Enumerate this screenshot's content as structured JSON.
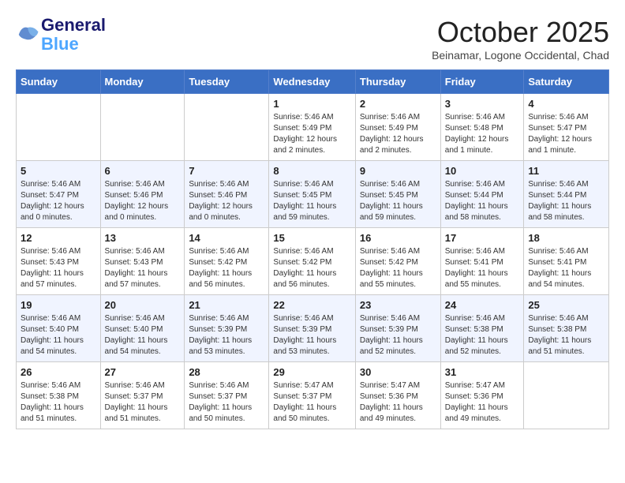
{
  "header": {
    "logo_line1": "General",
    "logo_line2": "Blue",
    "month": "October 2025",
    "location": "Beinamar, Logone Occidental, Chad"
  },
  "days_of_week": [
    "Sunday",
    "Monday",
    "Tuesday",
    "Wednesday",
    "Thursday",
    "Friday",
    "Saturday"
  ],
  "weeks": [
    [
      {
        "day": "",
        "info": ""
      },
      {
        "day": "",
        "info": ""
      },
      {
        "day": "",
        "info": ""
      },
      {
        "day": "1",
        "info": "Sunrise: 5:46 AM\nSunset: 5:49 PM\nDaylight: 12 hours\nand 2 minutes."
      },
      {
        "day": "2",
        "info": "Sunrise: 5:46 AM\nSunset: 5:49 PM\nDaylight: 12 hours\nand 2 minutes."
      },
      {
        "day": "3",
        "info": "Sunrise: 5:46 AM\nSunset: 5:48 PM\nDaylight: 12 hours\nand 1 minute."
      },
      {
        "day": "4",
        "info": "Sunrise: 5:46 AM\nSunset: 5:47 PM\nDaylight: 12 hours\nand 1 minute."
      }
    ],
    [
      {
        "day": "5",
        "info": "Sunrise: 5:46 AM\nSunset: 5:47 PM\nDaylight: 12 hours\nand 0 minutes."
      },
      {
        "day": "6",
        "info": "Sunrise: 5:46 AM\nSunset: 5:46 PM\nDaylight: 12 hours\nand 0 minutes."
      },
      {
        "day": "7",
        "info": "Sunrise: 5:46 AM\nSunset: 5:46 PM\nDaylight: 12 hours\nand 0 minutes."
      },
      {
        "day": "8",
        "info": "Sunrise: 5:46 AM\nSunset: 5:45 PM\nDaylight: 11 hours\nand 59 minutes."
      },
      {
        "day": "9",
        "info": "Sunrise: 5:46 AM\nSunset: 5:45 PM\nDaylight: 11 hours\nand 59 minutes."
      },
      {
        "day": "10",
        "info": "Sunrise: 5:46 AM\nSunset: 5:44 PM\nDaylight: 11 hours\nand 58 minutes."
      },
      {
        "day": "11",
        "info": "Sunrise: 5:46 AM\nSunset: 5:44 PM\nDaylight: 11 hours\nand 58 minutes."
      }
    ],
    [
      {
        "day": "12",
        "info": "Sunrise: 5:46 AM\nSunset: 5:43 PM\nDaylight: 11 hours\nand 57 minutes."
      },
      {
        "day": "13",
        "info": "Sunrise: 5:46 AM\nSunset: 5:43 PM\nDaylight: 11 hours\nand 57 minutes."
      },
      {
        "day": "14",
        "info": "Sunrise: 5:46 AM\nSunset: 5:42 PM\nDaylight: 11 hours\nand 56 minutes."
      },
      {
        "day": "15",
        "info": "Sunrise: 5:46 AM\nSunset: 5:42 PM\nDaylight: 11 hours\nand 56 minutes."
      },
      {
        "day": "16",
        "info": "Sunrise: 5:46 AM\nSunset: 5:42 PM\nDaylight: 11 hours\nand 55 minutes."
      },
      {
        "day": "17",
        "info": "Sunrise: 5:46 AM\nSunset: 5:41 PM\nDaylight: 11 hours\nand 55 minutes."
      },
      {
        "day": "18",
        "info": "Sunrise: 5:46 AM\nSunset: 5:41 PM\nDaylight: 11 hours\nand 54 minutes."
      }
    ],
    [
      {
        "day": "19",
        "info": "Sunrise: 5:46 AM\nSunset: 5:40 PM\nDaylight: 11 hours\nand 54 minutes."
      },
      {
        "day": "20",
        "info": "Sunrise: 5:46 AM\nSunset: 5:40 PM\nDaylight: 11 hours\nand 54 minutes."
      },
      {
        "day": "21",
        "info": "Sunrise: 5:46 AM\nSunset: 5:39 PM\nDaylight: 11 hours\nand 53 minutes."
      },
      {
        "day": "22",
        "info": "Sunrise: 5:46 AM\nSunset: 5:39 PM\nDaylight: 11 hours\nand 53 minutes."
      },
      {
        "day": "23",
        "info": "Sunrise: 5:46 AM\nSunset: 5:39 PM\nDaylight: 11 hours\nand 52 minutes."
      },
      {
        "day": "24",
        "info": "Sunrise: 5:46 AM\nSunset: 5:38 PM\nDaylight: 11 hours\nand 52 minutes."
      },
      {
        "day": "25",
        "info": "Sunrise: 5:46 AM\nSunset: 5:38 PM\nDaylight: 11 hours\nand 51 minutes."
      }
    ],
    [
      {
        "day": "26",
        "info": "Sunrise: 5:46 AM\nSunset: 5:38 PM\nDaylight: 11 hours\nand 51 minutes."
      },
      {
        "day": "27",
        "info": "Sunrise: 5:46 AM\nSunset: 5:37 PM\nDaylight: 11 hours\nand 51 minutes."
      },
      {
        "day": "28",
        "info": "Sunrise: 5:46 AM\nSunset: 5:37 PM\nDaylight: 11 hours\nand 50 minutes."
      },
      {
        "day": "29",
        "info": "Sunrise: 5:47 AM\nSunset: 5:37 PM\nDaylight: 11 hours\nand 50 minutes."
      },
      {
        "day": "30",
        "info": "Sunrise: 5:47 AM\nSunset: 5:36 PM\nDaylight: 11 hours\nand 49 minutes."
      },
      {
        "day": "31",
        "info": "Sunrise: 5:47 AM\nSunset: 5:36 PM\nDaylight: 11 hours\nand 49 minutes."
      },
      {
        "day": "",
        "info": ""
      }
    ]
  ]
}
